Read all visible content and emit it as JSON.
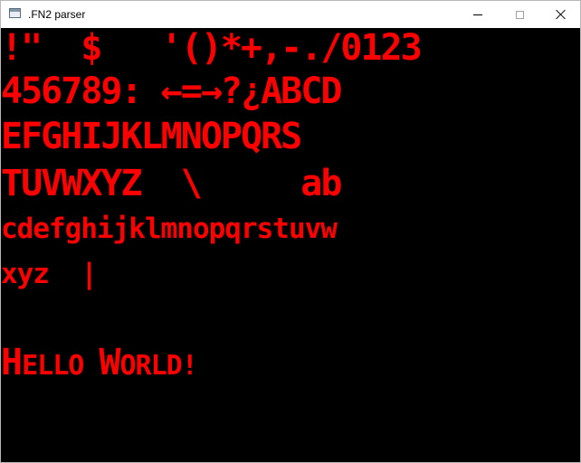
{
  "window": {
    "title": ".FN2 parser",
    "controls": {
      "minimize": "minimize",
      "maximize": "maximize",
      "close": "close"
    }
  },
  "font_preview": {
    "lines": [
      "!\"  $   '()*+,-./0123",
      "456789: ←=→?¿ABCD",
      "EFGHIJKLMNOPQRS",
      "TUVWXYZ  \\     ab",
      "cdefghijklmnopqrstuvw",
      "xyz  |"
    ],
    "hello": {
      "h_big": "H",
      "ello": "ELLO ",
      "w_big": "W",
      "orld": "ORLD!"
    }
  },
  "colors": {
    "text": "#ff0000",
    "background": "#000000",
    "titlebar": "#ffffff"
  }
}
